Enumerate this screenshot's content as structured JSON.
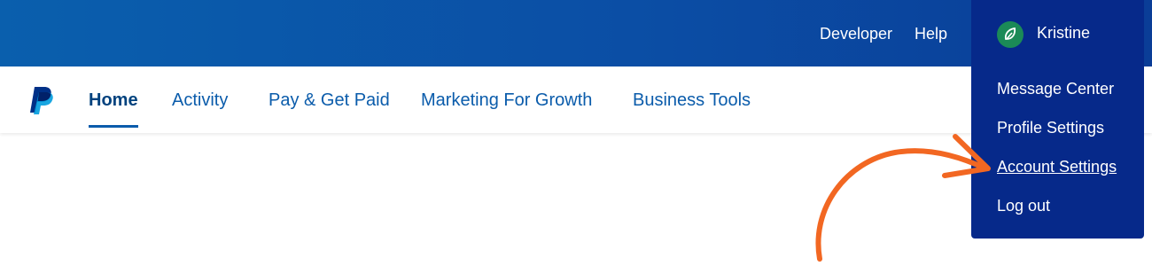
{
  "top_bar": {
    "links": [
      "Developer",
      "Help"
    ]
  },
  "nav": {
    "items": [
      "Home",
      "Activity",
      "Pay & Get Paid",
      "Marketing For Growth",
      "Business Tools"
    ],
    "active": "Home"
  },
  "user_menu": {
    "name": "Kristine",
    "items": [
      "Message Center",
      "Profile Settings",
      "Account Settings",
      "Log out"
    ],
    "highlighted": "Account Settings"
  },
  "icons": {
    "logo": "paypal-logo",
    "avatar": "leaf-avatar-icon",
    "annotation": "curved-arrow"
  },
  "colors": {
    "top_bar": "#0b4ea5",
    "dropdown": "#06298a",
    "nav_text": "#0b5cab",
    "avatar": "#1b8a57",
    "annotation_arrow": "#f26722"
  }
}
